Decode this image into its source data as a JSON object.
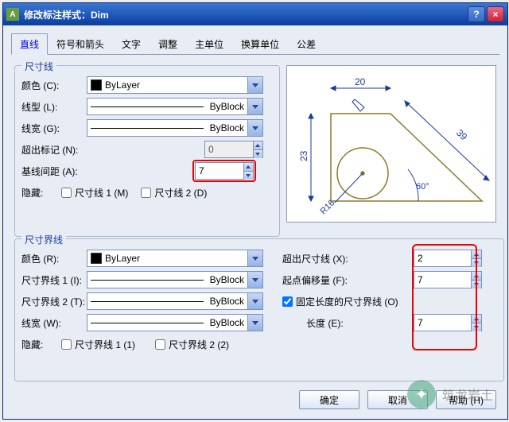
{
  "title": "修改标注样式：Dim",
  "tabs": [
    "直线",
    "符号和箭头",
    "文字",
    "调整",
    "主单位",
    "换算单位",
    "公差"
  ],
  "fs1": {
    "legend": "尺寸线",
    "color_lbl": "颜色 (C):",
    "color_val": "ByLayer",
    "ltype_lbl": "线型 (L):",
    "ltype_val": "ByBlock",
    "lw_lbl": "线宽 (G):",
    "lw_val": "ByBlock",
    "ext_lbl": "超出标记 (N):",
    "ext_val": "0",
    "base_lbl": "基线间距 (A):",
    "base_val": "7",
    "hide_lbl": "隐藏:",
    "chk1": "尺寸线 1 (M)",
    "chk2": "尺寸线 2 (D)"
  },
  "fs2": {
    "legend": "尺寸界线",
    "color_lbl": "颜色 (R):",
    "color_val": "ByLayer",
    "lt1_lbl": "尺寸界线 1 (I):",
    "lt1_val": "ByBlock",
    "lt2_lbl": "尺寸界线 2 (T):",
    "lt2_val": "ByBlock",
    "lw_lbl": "线宽 (W):",
    "lw_val": "ByBlock",
    "hide_lbl": "隐藏:",
    "chk1": "尺寸界线 1 (1)",
    "chk2": "尺寸界线 2 (2)",
    "extbeyond_lbl": "超出尺寸线 (X):",
    "extbeyond_val": "2",
    "offset_lbl": "起点偏移量 (F):",
    "offset_val": "7",
    "fixed_lbl": "固定长度的尺寸界线 (O)",
    "len_lbl": "长度 (E):",
    "len_val": "7"
  },
  "preview": {
    "d_top": "20",
    "d_left": "23",
    "d_right": "39",
    "angle": "60°",
    "radius": "R16"
  },
  "btns": {
    "ok": "确定",
    "cancel": "取消",
    "help": "帮助 (H)"
  },
  "wm": "筑龙岩土"
}
